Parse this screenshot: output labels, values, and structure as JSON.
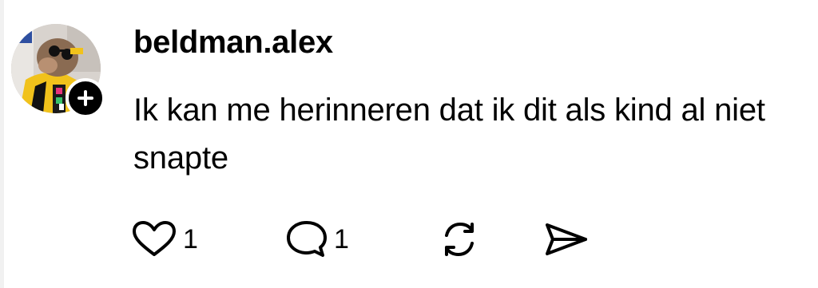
{
  "post": {
    "username": "beldman.alex",
    "text": "Ik kan me herinneren dat ik dit als kind al niet snapte"
  },
  "avatar": {
    "icon": "avatar-photo",
    "follow_icon": "plus-icon"
  },
  "actions": {
    "like": {
      "icon": "heart-icon",
      "count": "1"
    },
    "reply": {
      "icon": "comment-icon",
      "count": "1"
    },
    "repost": {
      "icon": "repost-icon"
    },
    "share": {
      "icon": "send-icon"
    }
  }
}
